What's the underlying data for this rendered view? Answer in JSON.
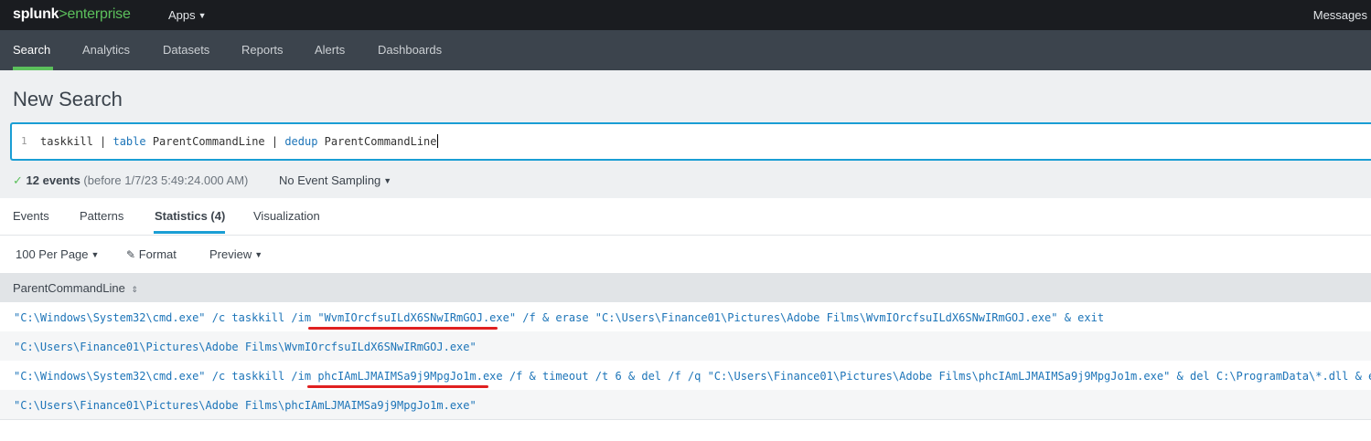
{
  "app": {
    "logo_splunk": "splunk",
    "logo_gt": ">",
    "logo_enterprise": "enterprise",
    "apps_label": "Apps",
    "messages_label": "Messages"
  },
  "nav": {
    "items": [
      "Search",
      "Analytics",
      "Datasets",
      "Reports",
      "Alerts",
      "Dashboards"
    ],
    "active": "Search"
  },
  "page": {
    "title": "New Search"
  },
  "search": {
    "line_number": "1",
    "query_parts": [
      "taskkill | ",
      "table",
      " ParentCommandLine | ",
      "dedup",
      " ParentCommandLine"
    ]
  },
  "status": {
    "check": "✓",
    "events": "12 events",
    "before": "(before 1/7/23 5:49:24.000 AM)",
    "sampling": "No Event Sampling"
  },
  "tabs": [
    "Events",
    "Patterns",
    "Statistics (4)",
    "Visualization"
  ],
  "toolbar": {
    "per_page": "100 Per Page",
    "format": "Format",
    "preview": "Preview"
  },
  "table": {
    "column": "ParentCommandLine",
    "rows": [
      "\"C:\\Windows\\System32\\cmd.exe\" /c taskkill /im \"WvmIOrcfsuILdX6SNwIRmGOJ.exe\" /f & erase \"C:\\Users\\Finance01\\Pictures\\Adobe Films\\WvmIOrcfsuILdX6SNwIRmGOJ.exe\" & exit",
      "\"C:\\Users\\Finance01\\Pictures\\Adobe Films\\WvmIOrcfsuILdX6SNwIRmGOJ.exe\"",
      "\"C:\\Windows\\System32\\cmd.exe\" /c taskkill /im phcIAmLJMAIMSa9j9MpgJo1m.exe /f & timeout /t 6 & del /f /q \"C:\\Users\\Finance01\\Pictures\\Adobe Films\\phcIAmLJMAIMSa9j9MpgJo1m.exe\" & del C:\\ProgramData\\*.dll & exit",
      "\"C:\\Users\\Finance01\\Pictures\\Adobe Films\\phcIAmLJMAIMSa9j9MpgJo1m.exe\""
    ]
  },
  "colors": {
    "accent_green": "#5cc05c",
    "accent_blue": "#1a9ed4",
    "link_blue": "#1c74b8",
    "annotation_red": "#e02020"
  }
}
